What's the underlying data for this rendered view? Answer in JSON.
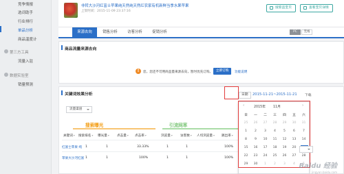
{
  "sidebar": {
    "items_top": [
      {
        "label": "竞争情报",
        "active": false
      },
      {
        "label": "选词助手",
        "active": false
      },
      {
        "label": "行业排行",
        "active": false
      },
      {
        "label": "单品分析",
        "active": true
      },
      {
        "label": "商品温度计",
        "active": false
      }
    ],
    "group_tools": "第三方工具",
    "tool_items": [
      {
        "label": "流量入驻"
      }
    ],
    "group_lab": "数据实验室",
    "lab_items": [
      {
        "label": "销量预测"
      }
    ]
  },
  "product": {
    "title": "非转大沙河红富士苹果纯天然纯天然红农家有机新鲜当季水果苹果",
    "date": "上架时间：2015-11-09 23:37:16",
    "btn_select": "搜索品宝贝",
    "btn_view": "查看宝贝详情"
  },
  "tabs": [
    {
      "label": "来源去向",
      "active": true
    },
    {
      "label": "销售分析",
      "active": false
    },
    {
      "label": "访客分析",
      "active": false
    },
    {
      "label": "促销分析",
      "active": false
    }
  ],
  "device": {
    "pc": "PC",
    "wireless": "无线"
  },
  "source_card": {
    "title": "商品流量来源去向",
    "notice_icon": "!",
    "notice": "您，您还不可用商品量来源去向，暂时优先订购。",
    "buy_btn": "立即订购",
    "learn_more": "功能说明"
  },
  "keyword_card": {
    "title": "关键词效果分析",
    "date_btn": "日期",
    "date_range": "2015-11-21~2015-11-21",
    "download": "下载",
    "filter_select": "流量渠道",
    "group_search": "搜索曝光",
    "group_lead": "引流网率",
    "columns": [
      "关键词",
      "搜索排名",
      "曝光量",
      "点击量",
      "点击率",
      "浏览量",
      "访客数",
      "人均浏览量",
      "跳出率"
    ],
    "rows": [
      {
        "keyword": "红富士苹果 纯",
        "values": [
          "1",
          "",
          "1",
          "",
          "33.33%",
          "1",
          "1",
          "",
          "100%"
        ]
      },
      {
        "keyword": "苹果大沙河红富",
        "values": [
          "1",
          "",
          "1",
          "",
          "100%",
          "1",
          "1",
          "",
          "100%"
        ]
      }
    ]
  },
  "calendar": {
    "prev": "‹",
    "next": "›",
    "year": "2015年",
    "month": "11月",
    "weekdays": [
      "日",
      "一",
      "二",
      "三",
      "四",
      "五",
      "六"
    ],
    "weeks": [
      [
        "25",
        "26",
        "27",
        "28",
        "29",
        "30",
        "31"
      ],
      [
        "1",
        "2",
        "3",
        "4",
        "5",
        "6",
        "7"
      ],
      [
        "8",
        "9",
        "10",
        "11",
        "12",
        "13",
        "14"
      ],
      [
        "15",
        "16",
        "17",
        "18",
        "19",
        "20",
        "21"
      ],
      [
        "22",
        "23",
        "24",
        "25",
        "26",
        "27",
        "28"
      ],
      [
        "29",
        "30",
        "1",
        "2",
        "3",
        "4",
        "5"
      ]
    ],
    "selected": "21"
  },
  "watermark": {
    "brand": "Baidu 经验",
    "sub": "jingyan.baidu.com"
  },
  "colors": {
    "accent": "#2b6fc7",
    "teal": "#3aa7a1",
    "orange": "#f39c12",
    "green": "#7fc77b",
    "highlight": "#e23b3b"
  }
}
